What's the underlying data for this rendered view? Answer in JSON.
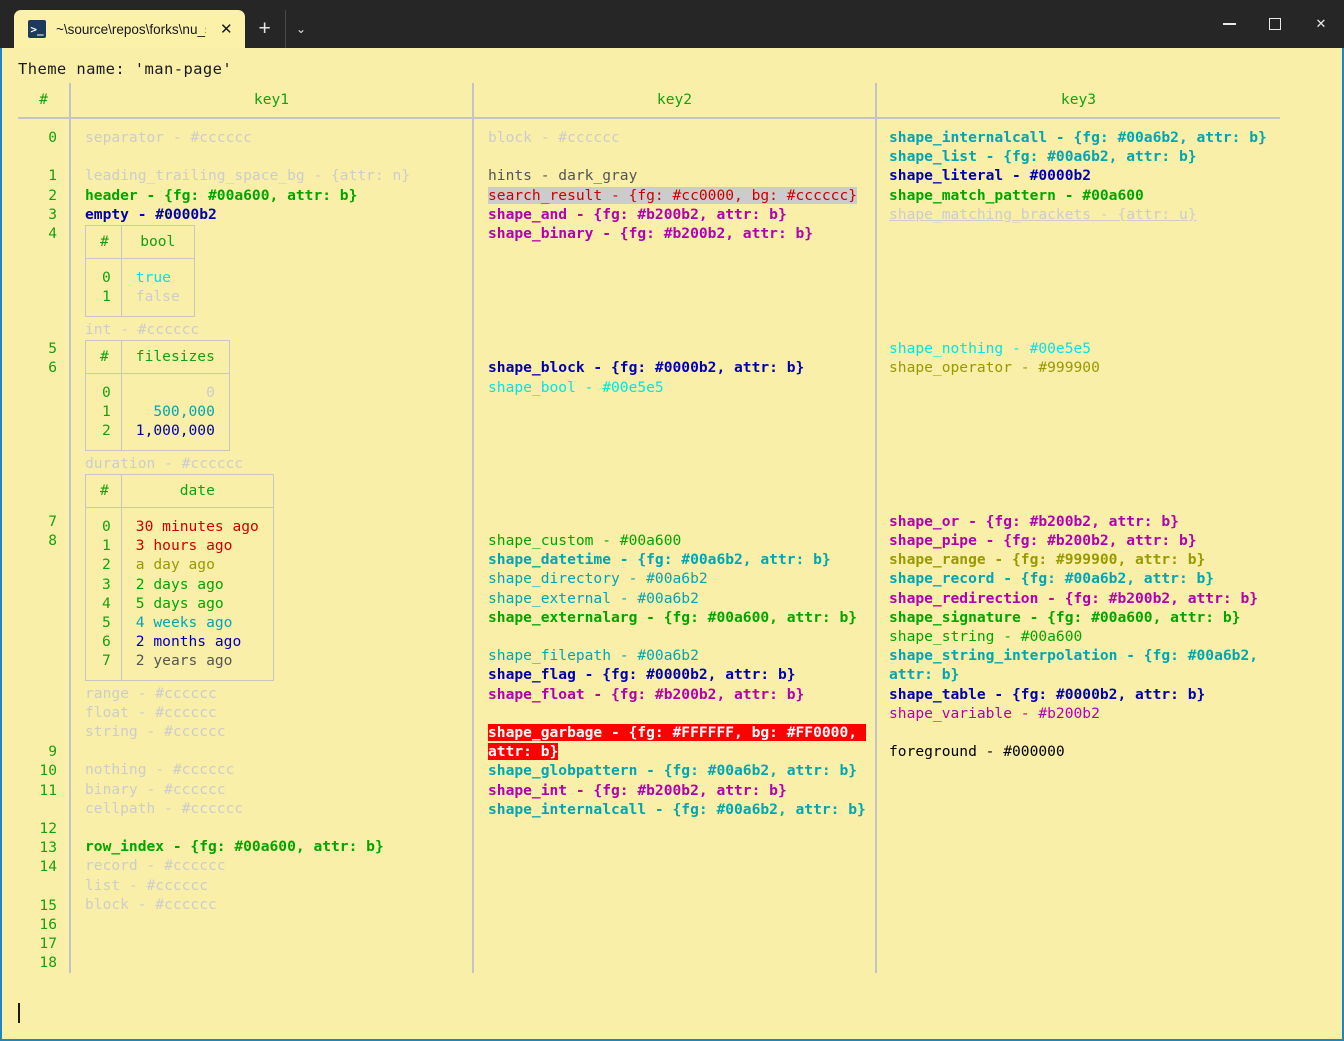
{
  "window": {
    "tab": {
      "icon": "terminal-icon",
      "title": "~\\source\\repos\\forks\\nu_scrip",
      "close": "✕"
    },
    "new_tab": "+",
    "tab_menu": "⌄",
    "controls": {
      "minimize": "—",
      "maximize": "□",
      "close": "✕"
    }
  },
  "terminal": {
    "theme_line": "Theme name: 'man-page'",
    "prompt_cursor": ""
  },
  "table": {
    "headers": {
      "index": "#",
      "key1": "key1",
      "key2": "key2",
      "key3": "key3"
    },
    "row_numbers": [
      "0",
      "1",
      "2",
      "3",
      "4",
      "5",
      "6",
      "7",
      "8",
      "9",
      "10",
      "11",
      "12",
      "13",
      "14",
      "15",
      "16",
      "17",
      "18"
    ],
    "key1": [
      {
        "text": "separator - #cccccc",
        "color": "#cccccc"
      },
      {
        "text": "",
        "blank": true
      },
      {
        "text": "leading_trailing_space_bg - {attr: n}",
        "color": "#cccccc"
      },
      {
        "text": "header - {fg: #00a600, attr: b}",
        "color": "#00a600",
        "bold": true
      },
      {
        "text": "empty - #0000b2",
        "color": "#0000b2",
        "bold": true
      }
    ],
    "key1_bool_table": {
      "headers": [
        "#",
        "bool"
      ],
      "rows": [
        {
          "n": "0",
          "value": "true",
          "color": "#00e5e5"
        },
        {
          "n": "1",
          "value": "false",
          "color": "#cccccc"
        }
      ]
    },
    "key1_int_line": {
      "text": "int - #cccccc",
      "color": "#cccccc"
    },
    "key1_filesizes_table": {
      "headers": [
        "#",
        "filesizes"
      ],
      "rows": [
        {
          "n": "0",
          "value": "0",
          "color": "#cccccc"
        },
        {
          "n": "1",
          "value": "500,000",
          "color": "#00a6b2"
        },
        {
          "n": "2",
          "value": "1,000,000",
          "color": "#0000b2"
        }
      ]
    },
    "key1_duration_line": {
      "text": "duration - #cccccc",
      "color": "#cccccc"
    },
    "key1_date_table": {
      "headers": [
        "#",
        "date"
      ],
      "rows": [
        {
          "n": "0",
          "value": "30 minutes ago",
          "color": "#cc0000"
        },
        {
          "n": "1",
          "value": "3 hours ago",
          "color": "#cc0000"
        },
        {
          "n": "2",
          "value": "a day ago",
          "color": "#999900"
        },
        {
          "n": "3",
          "value": "2 days ago",
          "color": "#00a600"
        },
        {
          "n": "4",
          "value": "5 days ago",
          "color": "#00a600"
        },
        {
          "n": "5",
          "value": "4 weeks ago",
          "color": "#00a6b2"
        },
        {
          "n": "6",
          "value": "2 months ago",
          "color": "#0000b2"
        },
        {
          "n": "7",
          "value": "2 years ago",
          "color": "#555555"
        }
      ]
    },
    "key1_tail": [
      {
        "text": "range - #cccccc",
        "color": "#cccccc"
      },
      {
        "text": "float - #cccccc",
        "color": "#cccccc"
      },
      {
        "text": "string - #cccccc",
        "color": "#cccccc"
      },
      {
        "text": "",
        "blank": true
      },
      {
        "text": "nothing - #cccccc",
        "color": "#cccccc"
      },
      {
        "text": "binary - #cccccc",
        "color": "#cccccc"
      },
      {
        "text": "cellpath - #cccccc",
        "color": "#cccccc"
      },
      {
        "text": "",
        "blank": true
      },
      {
        "text": "row_index - {fg: #00a600, attr: b}",
        "color": "#00a600",
        "bold": true
      },
      {
        "text": "record - #cccccc",
        "color": "#cccccc"
      },
      {
        "text": "list - #cccccc",
        "color": "#cccccc"
      },
      {
        "text": "block - #cccccc",
        "color": "#cccccc"
      }
    ],
    "key2": [
      {
        "text": "block - #cccccc",
        "color": "#cccccc"
      },
      {
        "text": "",
        "blank": true
      },
      {
        "text": "hints - dark_gray",
        "color": "#555555"
      },
      {
        "text": "search_result - {fg: #cc0000, bg: #cccccc}",
        "color": "#cc0000",
        "bg": "#cccccc"
      },
      {
        "text": "shape_and - {fg: #b200b2, attr: b}",
        "color": "#b200b2",
        "bold": true
      },
      {
        "text": "shape_binary - {fg: #b200b2, attr: b}",
        "color": "#b200b2",
        "bold": true
      },
      {
        "text": "",
        "blank": true
      },
      {
        "text": "",
        "blank": true
      },
      {
        "text": "",
        "blank": true
      },
      {
        "text": "",
        "blank": true
      },
      {
        "text": "",
        "blank": true
      },
      {
        "text": "",
        "blank": true
      },
      {
        "text": "shape_block - {fg: #0000b2, attr: b}",
        "color": "#0000b2",
        "bold": true
      },
      {
        "text": "shape_bool - #00e5e5",
        "color": "#00e5e5"
      },
      {
        "text": "",
        "blank": true
      },
      {
        "text": "",
        "blank": true
      },
      {
        "text": "",
        "blank": true
      },
      {
        "text": "",
        "blank": true
      },
      {
        "text": "",
        "blank": true
      },
      {
        "text": "",
        "blank": true
      },
      {
        "text": "",
        "blank": true
      },
      {
        "text": "shape_custom - #00a600",
        "color": "#00a600"
      },
      {
        "text": "shape_datetime - {fg: #00a6b2, attr: b}",
        "color": "#00a6b2",
        "bold": true
      }
    ],
    "key2_tail": [
      {
        "text": "shape_directory - #00a6b2",
        "color": "#00a6b2"
      },
      {
        "text": "shape_external - #00a6b2",
        "color": "#00a6b2"
      },
      {
        "text": "shape_externalarg - {fg: #00a600, attr: b}",
        "color": "#00a600",
        "bold": true
      },
      {
        "text": "",
        "blank": true
      },
      {
        "text": "shape_filepath - #00a6b2",
        "color": "#00a6b2"
      },
      {
        "text": "shape_flag - {fg: #0000b2, attr: b}",
        "color": "#0000b2",
        "bold": true
      },
      {
        "text": "shape_float - {fg: #b200b2, attr: b}",
        "color": "#b200b2",
        "bold": true
      },
      {
        "text": "",
        "blank": true
      },
      {
        "text": "shape_garbage - {fg: #FFFFFF, bg: #FF0000, attr: b}",
        "color": "#ffffff",
        "bg": "#ff0000",
        "bold": true
      },
      {
        "text": "shape_globpattern - {fg: #00a6b2, attr: b}",
        "color": "#00a6b2",
        "bold": true
      },
      {
        "text": "shape_int - {fg: #b200b2, attr: b}",
        "color": "#b200b2",
        "bold": true
      },
      {
        "text": "shape_internalcall - {fg: #00a6b2, attr: b}",
        "color": "#00a6b2",
        "bold": true
      }
    ],
    "key3": [
      {
        "text": "shape_internalcall - {fg: #00a6b2, attr: b}",
        "color": "#00a6b2",
        "bold": true
      },
      {
        "text": "shape_list - {fg: #00a6b2, attr: b}",
        "color": "#00a6b2",
        "bold": true
      },
      {
        "text": "shape_literal - #0000b2",
        "color": "#0000b2",
        "bold": true
      },
      {
        "text": "shape_match_pattern - #00a600",
        "color": "#00a600",
        "bold": true
      },
      {
        "text": "shape_matching_brackets - {attr: u}",
        "color": "#cccccc",
        "underline": true
      },
      {
        "text": "",
        "blank": true
      },
      {
        "text": "",
        "blank": true
      },
      {
        "text": "",
        "blank": true
      },
      {
        "text": "",
        "blank": true
      },
      {
        "text": "",
        "blank": true
      },
      {
        "text": "",
        "blank": true
      },
      {
        "text": "shape_nothing - #00e5e5",
        "color": "#00e5e5"
      },
      {
        "text": "shape_operator - #999900",
        "color": "#999900"
      },
      {
        "text": "",
        "blank": true
      },
      {
        "text": "",
        "blank": true
      },
      {
        "text": "",
        "blank": true
      },
      {
        "text": "",
        "blank": true
      },
      {
        "text": "",
        "blank": true
      },
      {
        "text": "",
        "blank": true
      },
      {
        "text": "",
        "blank": true
      },
      {
        "text": "shape_or - {fg: #b200b2, attr: b}",
        "color": "#b200b2",
        "bold": true
      },
      {
        "text": "shape_pipe - {fg: #b200b2, attr: b}",
        "color": "#b200b2",
        "bold": true
      }
    ],
    "key3_tail": [
      {
        "text": "shape_range - {fg: #999900, attr: b}",
        "color": "#999900",
        "bold": true
      },
      {
        "text": "shape_record - {fg: #00a6b2, attr: b}",
        "color": "#00a6b2",
        "bold": true
      },
      {
        "text": "shape_redirection - {fg: #b200b2, attr: b}",
        "color": "#b200b2",
        "bold": true
      },
      {
        "text": "shape_signature - {fg: #00a600, attr: b}",
        "color": "#00a600",
        "bold": true
      },
      {
        "text": "shape_string - #00a600",
        "color": "#00a600"
      },
      {
        "text": "shape_string_interpolation - {fg: #00a6b2, attr: b}",
        "color": "#00a6b2",
        "bold": true
      },
      {
        "text": "shape_table - {fg: #0000b2, attr: b}",
        "color": "#0000b2",
        "bold": true
      },
      {
        "text": "shape_variable - #b200b2",
        "color": "#b200b2"
      },
      {
        "text": "",
        "blank": true
      },
      {
        "text": "foreground - #000000",
        "color": "#000000"
      }
    ]
  },
  "colors": {
    "terminal_bg": "#faefa8",
    "window_bg": "#262626",
    "border_accent": "#1a85c8",
    "grid": "#c4c4c4",
    "header_text": "#15a012"
  }
}
